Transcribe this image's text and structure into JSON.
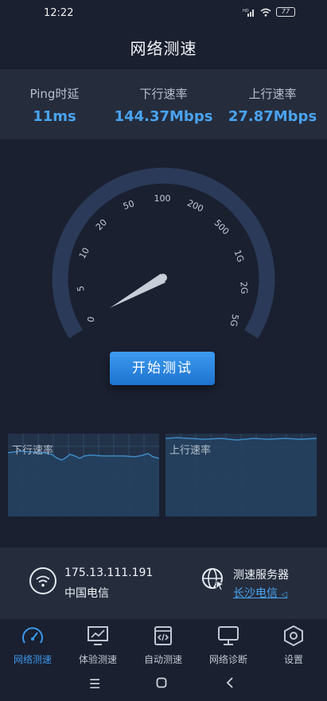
{
  "status": {
    "time": "12:22",
    "battery": "77",
    "network": "HD"
  },
  "title": "网络测速",
  "stats": [
    {
      "label": "Ping时延",
      "value": "11ms"
    },
    {
      "label": "下行速率",
      "value": "144.37Mbps"
    },
    {
      "label": "上行速率",
      "value": "27.87Mbps"
    }
  ],
  "gauge": {
    "ticks": [
      "0",
      "5",
      "10",
      "20",
      "50",
      "100",
      "200",
      "500",
      "1G",
      "2G",
      "5G"
    ]
  },
  "start_button": "开始测试",
  "charts": {
    "down_label": "下行速率",
    "up_label": "上行速率"
  },
  "info": {
    "ip": "175.13.111.191",
    "isp": "中国电信",
    "server_title": "测速服务器",
    "server_name": "长沙电信"
  },
  "tabs": [
    {
      "label": "网络测速",
      "icon": "speedometer-icon",
      "active": true
    },
    {
      "label": "体验测速",
      "icon": "monitor-chart-icon",
      "active": false
    },
    {
      "label": "自动测速",
      "icon": "code-file-icon",
      "active": false
    },
    {
      "label": "网络诊断",
      "icon": "monitor-icon",
      "active": false
    },
    {
      "label": "设置",
      "icon": "gear-icon",
      "active": false
    }
  ],
  "colors": {
    "accent": "#3b97ea",
    "background": "#1a2030",
    "panel": "#252d3d"
  }
}
